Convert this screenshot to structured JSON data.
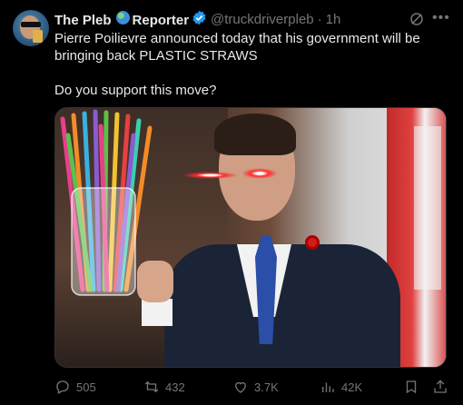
{
  "author": {
    "display_name_part1": "The Pleb",
    "display_name_part2": "Reporter",
    "handle": "@truckdriverpleb",
    "separator": "·",
    "time": "1h"
  },
  "tweet": {
    "line1": "Pierre Poilievre announced today that his government will be",
    "line2": "bringing back PLASTIC STRAWS",
    "line3": "Do you support this move?"
  },
  "actions": {
    "replies": "505",
    "retweets": "432",
    "likes": "3.7K",
    "views": "42K"
  },
  "colors": {
    "background": "#000000",
    "text": "#e7e9ea",
    "muted": "#71767b",
    "verified": "#1d9bf0"
  },
  "icons": [
    "globe-emoji-icon",
    "verified-badge-icon",
    "grok-icon",
    "more-icon",
    "reply-icon",
    "retweet-icon",
    "like-icon",
    "views-icon",
    "bookmark-icon",
    "share-icon"
  ]
}
